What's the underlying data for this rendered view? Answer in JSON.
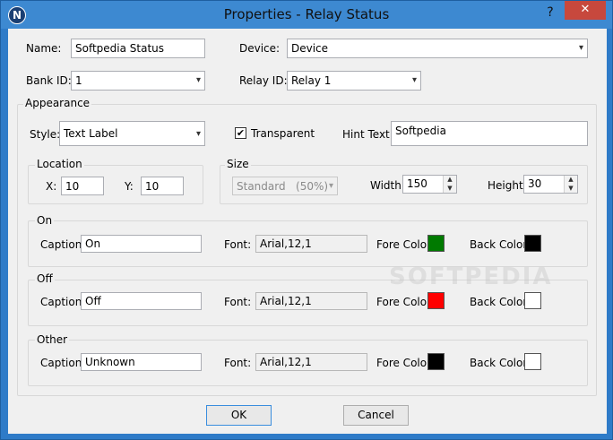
{
  "window": {
    "title": "Properties - Relay Status",
    "help_label": "?",
    "close_label": "✕"
  },
  "fields": {
    "name_label": "Name:",
    "name_value": "Softpedia Status",
    "device_label": "Device:",
    "device_value": "Device",
    "bank_label": "Bank ID:",
    "bank_value": "1",
    "relay_label": "Relay ID:",
    "relay_value": "Relay 1"
  },
  "appearance": {
    "title": "Appearance",
    "style_label": "Style:",
    "style_value": "Text Label",
    "transparent_label": "Transparent",
    "transparent_checked": true,
    "hint_label": "Hint Text:",
    "hint_value": "Softpedia",
    "location": {
      "title": "Location",
      "x_label": "X:",
      "x_value": "10",
      "y_label": "Y:",
      "y_value": "10"
    },
    "size": {
      "title": "Size",
      "preset_value": "Standard   (50%)",
      "width_label": "Width:",
      "width_value": "150",
      "height_label": "Height:",
      "height_value": "30"
    }
  },
  "states": [
    {
      "title": "On",
      "caption_label": "Caption:",
      "caption": "On",
      "font_label": "Font:",
      "font": "Arial,12,1",
      "fore_label": "Fore Color:",
      "fore_color": "#007a00",
      "back_label": "Back Color:",
      "back_color": "#000000"
    },
    {
      "title": "Off",
      "caption_label": "Caption:",
      "caption": "Off",
      "font_label": "Font:",
      "font": "Arial,12,1",
      "fore_label": "Fore Color:",
      "fore_color": "#ff0000",
      "back_label": "Back Color:",
      "back_color": "#ffffff"
    },
    {
      "title": "Other",
      "caption_label": "Caption:",
      "caption": "Unknown",
      "font_label": "Font:",
      "font": "Arial,12,1",
      "fore_label": "Fore Color:",
      "fore_color": "#000000",
      "back_label": "Back Color:",
      "back_color": "#ffffff"
    }
  ],
  "buttons": {
    "ok": "OK",
    "cancel": "Cancel"
  },
  "watermark": "SOFTPEDIA",
  "icons": {
    "app": "N",
    "chevron": "▾",
    "up": "▲",
    "down": "▼",
    "check": "✔"
  }
}
